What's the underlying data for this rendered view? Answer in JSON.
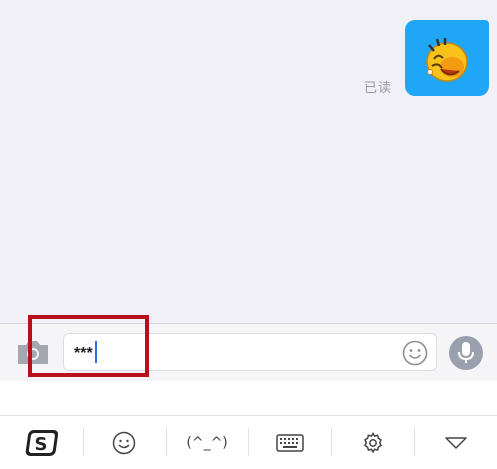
{
  "chat": {
    "read_status": "已读",
    "message_sticker": "laughing-face-sticker"
  },
  "input_bar": {
    "text_value": "***",
    "camera_icon": "camera-icon",
    "emoji_icon": "smiley-icon",
    "voice_icon": "microphone-icon"
  },
  "keyboard_toolbar": {
    "items": [
      {
        "name": "sogou-logo-button",
        "icon": "sogou-s-logo"
      },
      {
        "name": "emoji-button",
        "icon": "smiley-icon"
      },
      {
        "name": "kaomoji-button",
        "label": "(^_^)"
      },
      {
        "name": "keyboard-button",
        "icon": "keyboard-icon"
      },
      {
        "name": "settings-button",
        "icon": "gear-icon"
      },
      {
        "name": "collapse-keyboard-button",
        "icon": "triangle-down-icon"
      }
    ]
  },
  "colors": {
    "bubble": "#1fa6f7",
    "highlight": "#b8101a",
    "caret": "#2b6fe0"
  }
}
